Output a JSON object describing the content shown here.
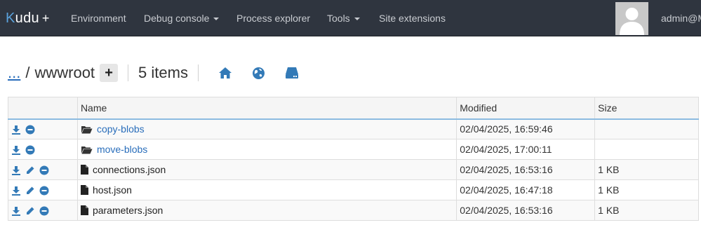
{
  "nav": {
    "brand_k": "K",
    "brand_rest": "udu",
    "brand_plus": "+",
    "items": [
      {
        "label": "Environment"
      },
      {
        "label": "Debug console"
      },
      {
        "label": "Process explorer"
      },
      {
        "label": "Tools"
      },
      {
        "label": "Site extensions"
      }
    ],
    "user": "admin@M"
  },
  "breadcrumb": {
    "up": "...",
    "sep": "/",
    "folder": "wwwroot",
    "add": "+",
    "count": "5 items"
  },
  "table": {
    "headers": {
      "name": "Name",
      "modified": "Modified",
      "size": "Size"
    },
    "rows": [
      {
        "name": "copy-blobs",
        "modified": "02/04/2025, 16:59:46",
        "size": ""
      },
      {
        "name": "move-blobs",
        "modified": "02/04/2025, 17:00:11",
        "size": ""
      },
      {
        "name": "connections.json",
        "modified": "02/04/2025, 16:53:16",
        "size": "1 KB"
      },
      {
        "name": "host.json",
        "modified": "02/04/2025, 16:47:18",
        "size": "1 KB"
      },
      {
        "name": "parameters.json",
        "modified": "02/04/2025, 16:53:16",
        "size": "1 KB"
      }
    ]
  },
  "colors": {
    "navbar": "#2f353f",
    "accent": "#2a6ebb",
    "icon_blue": "#337ab7"
  }
}
